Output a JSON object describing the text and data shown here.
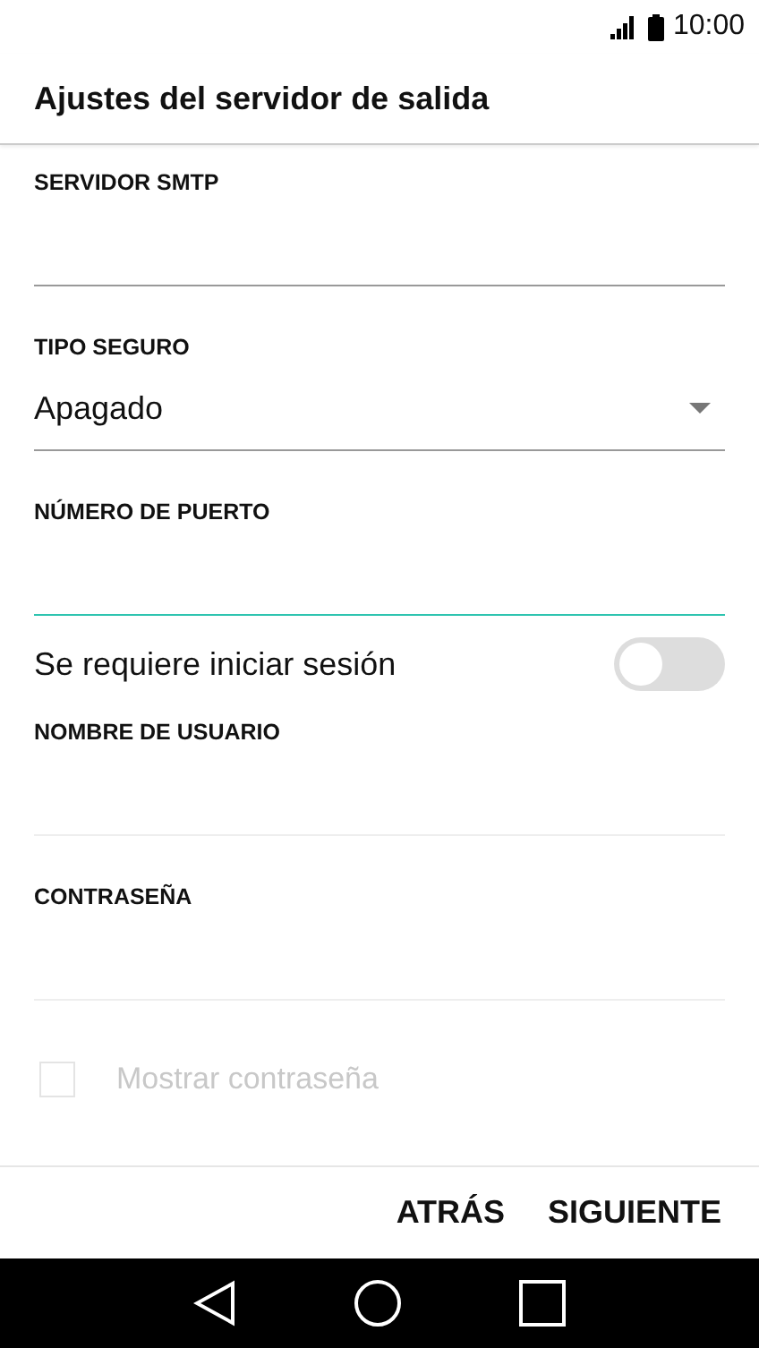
{
  "status_bar": {
    "time": "10:00"
  },
  "title": "Ajustes del servidor de salida",
  "fields": [
    {
      "kind": "text",
      "label": "SERVIDOR SMTP",
      "focused": false,
      "disabled": false
    },
    {
      "kind": "dropdown",
      "label": "TIPO SEGURO",
      "value": "Apagado",
      "focused": false,
      "disabled": false
    },
    {
      "kind": "text",
      "label": "NÚMERO DE PUERTO",
      "focused": true,
      "disabled": false
    }
  ],
  "login_toggle": {
    "label": "Se requiere iniciar sesión",
    "on": false
  },
  "login_fields": [
    {
      "kind": "text",
      "label": "NOMBRE DE USUARIO",
      "focused": false,
      "disabled": true
    },
    {
      "kind": "text",
      "label": "CONTRASEÑA",
      "focused": false,
      "disabled": true
    }
  ],
  "show_password": {
    "label": "Mostrar contraseña",
    "checked": false,
    "disabled": true
  },
  "buttons": [
    "ATRÁS",
    "SIGUIENTE"
  ]
}
